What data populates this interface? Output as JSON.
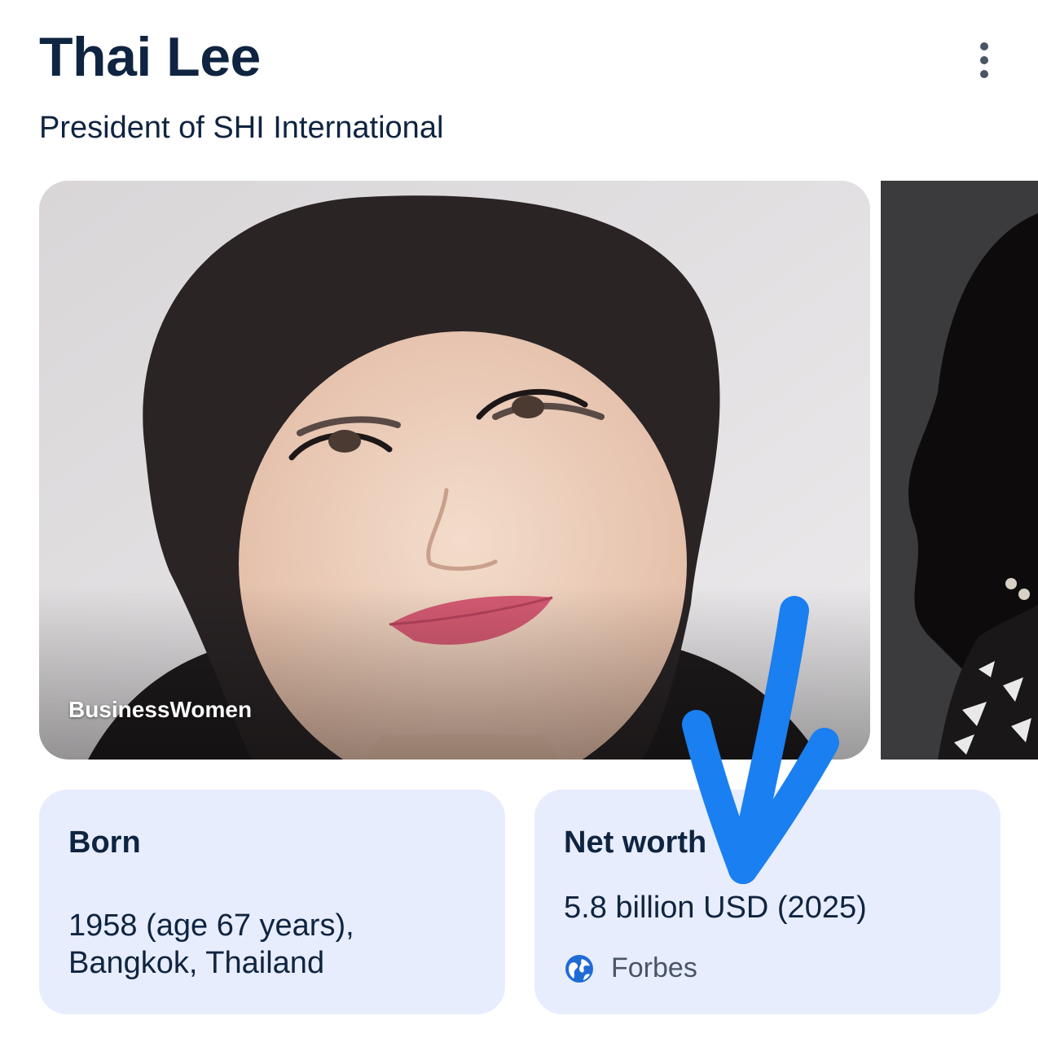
{
  "header": {
    "title": "Thai Lee",
    "subtitle": "President of SHI International",
    "more_icon": "more-vertical-icon"
  },
  "images": {
    "main_source": "BusinessWomen"
  },
  "facts": {
    "born": {
      "label": "Born",
      "value": "1958 (age 67 years), Bangkok, Thailand"
    },
    "net_worth": {
      "label": "Net worth",
      "value": "5.8 billion USD (2025)",
      "source_icon": "globe-icon",
      "source": "Forbes"
    }
  },
  "colors": {
    "title": "#0f2440",
    "card_background": "#e7edfc",
    "annotation_arrow": "#1a7ff0",
    "source_icon": "#1f6bd6"
  }
}
